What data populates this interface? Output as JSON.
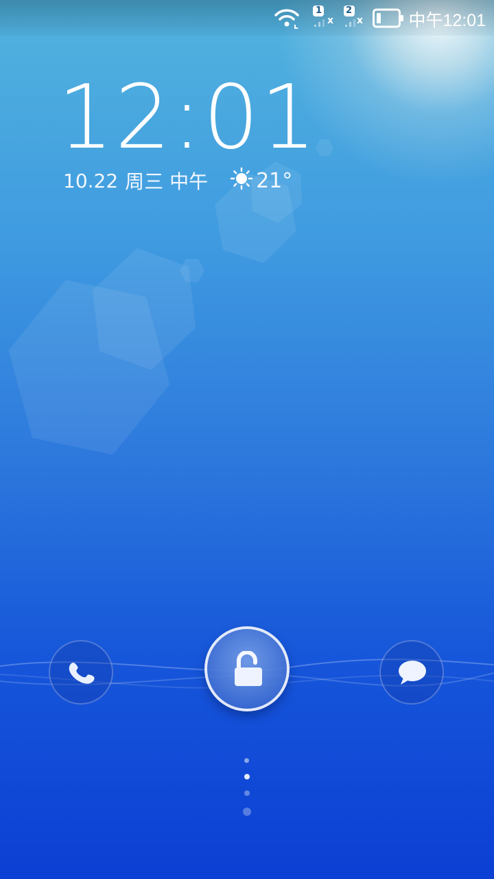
{
  "status_bar": {
    "time": "中午12:01",
    "sim1_label": "1",
    "sim2_label": "2",
    "sim_no_signal": "x",
    "wifi_icon": "wifi-icon",
    "battery_icon": "battery-icon"
  },
  "lockscreen": {
    "clock": "12:01",
    "date": "10.22",
    "weekday_period": "周三 中午",
    "weather_icon": "sun-icon",
    "temperature": "21°"
  },
  "actions": {
    "phone_icon": "phone-icon",
    "unlock_icon": "unlock-icon",
    "message_icon": "message-icon"
  },
  "page_indicator": {
    "count": 4,
    "active_index": 1
  },
  "colors": {
    "background_top": "#52b3de",
    "background_bottom": "#0c3fd4",
    "text": "#ffffff"
  }
}
